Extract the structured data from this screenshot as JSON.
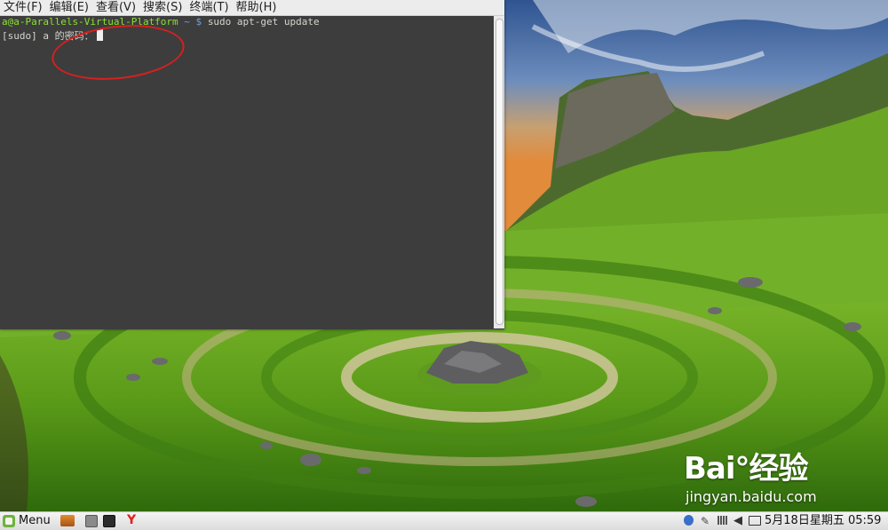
{
  "terminal": {
    "menu": [
      "文件(F)",
      "编辑(E)",
      "查看(V)",
      "搜索(S)",
      "终端(T)",
      "帮助(H)"
    ],
    "prompt_user": "a@a-Parallels-Virtual-Platform",
    "prompt_path": " ~ $ ",
    "command": "sudo apt-get update",
    "output_line": "[sudo] a 的密码："
  },
  "watermark": {
    "logo": "Bai°经验",
    "url": "jingyan.baidu.com"
  },
  "taskbar": {
    "menu_label": "Menu",
    "launchers": [
      "files-icon",
      "file-manager-icon",
      "terminal-icon",
      "yandex-browser-icon"
    ],
    "clock": "5月18日星期五 05:59"
  }
}
